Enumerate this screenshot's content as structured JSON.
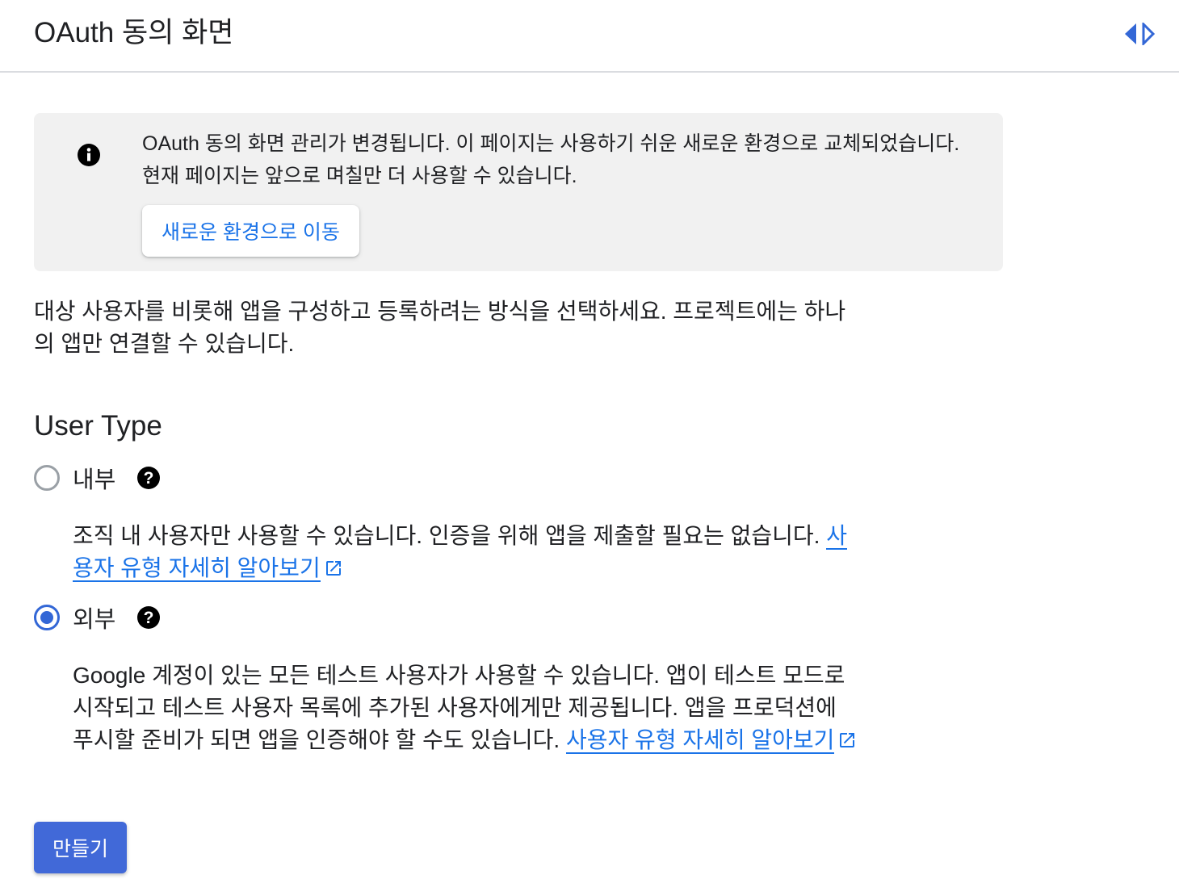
{
  "header": {
    "title": "OAuth 동의 화면",
    "toggle_icon": "collapse-panel-icon"
  },
  "banner": {
    "icon": "info-icon",
    "message": "OAuth 동의 화면 관리가 변경됩니다. 이 페이지는 사용하기 쉬운 새로운 환경으로 교체되었습니다. 현재 페이지는 앞으로 며칠만 더 사용할 수 있습니다.",
    "button_label": "새로운 환경으로 이동"
  },
  "description": "대상 사용자를 비롯해 앱을 구성하고 등록하려는 방식을 선택하세요. 프로젝트에는 하나의 앱만 연결할 수 있습니다.",
  "user_type": {
    "title": "User Type",
    "options": [
      {
        "label": "내부",
        "selected": false,
        "description": "조직 내 사용자만 사용할 수 있습니다. 인증을 위해 앱을 제출할 필요는 없습니다.",
        "link_text": "사용자 유형 자세히 알아보기"
      },
      {
        "label": "외부",
        "selected": true,
        "description": "Google 계정이 있는 모든 테스트 사용자가 사용할 수 있습니다. 앱이 테스트 모드로 시작되고 테스트 사용자 목록에 추가된 사용자에게만 제공됩니다. 앱을 프로덕션에 푸시할 준비가 되면 앱을 인증해야 할 수도 있습니다.",
        "link_text": "사용자 유형 자세히 알아보기"
      }
    ]
  },
  "actions": {
    "create_label": "만들기"
  },
  "colors": {
    "accent": "#1a73e8",
    "primary_button": "#4169d8",
    "banner_bg": "#f1f1f1"
  }
}
